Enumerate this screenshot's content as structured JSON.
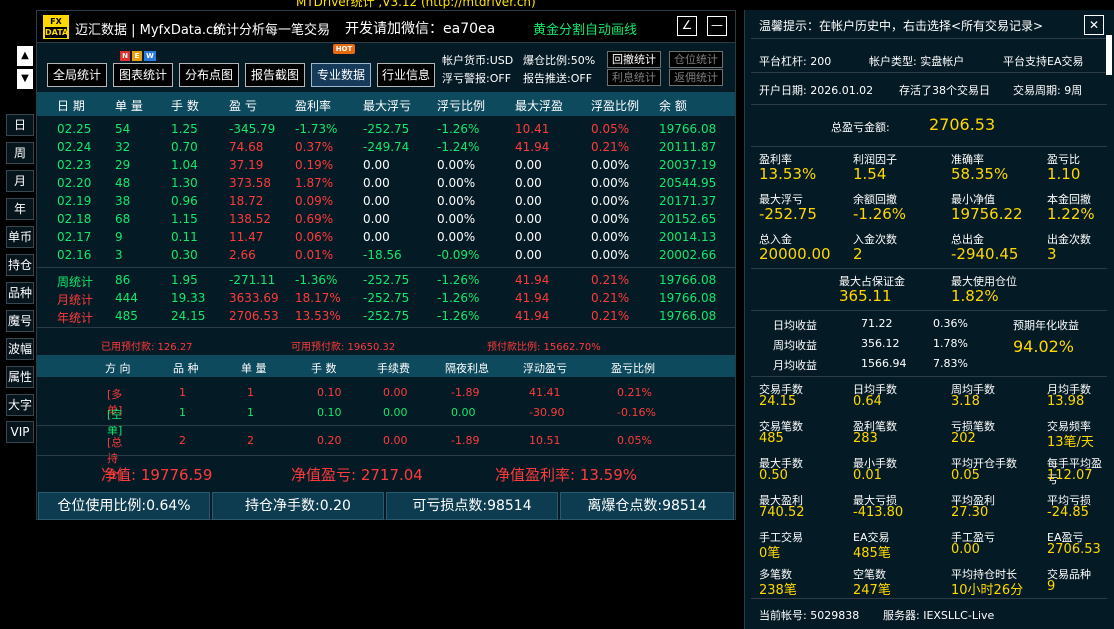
{
  "top_caption": "MTDriver统计 ,V3.12 (http://mtdriver.cn)",
  "side_nav": {
    "up": "▲",
    "down": "▼",
    "items": [
      "日",
      "周",
      "月",
      "年",
      "单币",
      "持仓",
      "品种",
      "魔号",
      "波幅",
      "属性",
      "大字",
      "VIP"
    ]
  },
  "title": {
    "logo_top": "FX",
    "logo_bottom": "DATA",
    "brand": "迈汇数据 | MyfxData.cn",
    "desc": "统计分析每一笔交易",
    "wechat": "开发请加微信：ea70ea",
    "gold": "黄金分割自动画线",
    "btn_edit": "∠",
    "btn_min": "—"
  },
  "toolbar": {
    "buttons": [
      "全局统计",
      "图表统计",
      "分布点图",
      "报告截图",
      "专业数据",
      "行业信息"
    ],
    "badges": {
      "new": [
        "N",
        "E",
        "W"
      ],
      "hot": "HOT"
    },
    "options": {
      "currency": "帐户货币:USD",
      "bust_ratio": "爆仓比例:50%",
      "float_alert": "浮亏警报:OFF",
      "report_push": "报告推送:OFF"
    },
    "small_buttons": [
      "回撤统计",
      "仓位统计",
      "利息统计",
      "返佣统计"
    ]
  },
  "table": {
    "headers": [
      "日 期",
      "单 量",
      "手 数",
      "盈 亏",
      "盈利率",
      "最大浮亏",
      "浮亏比例",
      "最大浮盈",
      "浮盈比例",
      "余 额"
    ],
    "rows": [
      [
        "02.25",
        "54",
        "1.25",
        "-345.79",
        "-1.73%",
        "-252.75",
        "-1.26%",
        "10.41",
        "0.05%",
        "19766.08"
      ],
      [
        "02.24",
        "32",
        "0.70",
        "74.68",
        "0.37%",
        "-249.74",
        "-1.24%",
        "41.94",
        "0.21%",
        "20111.87"
      ],
      [
        "02.23",
        "29",
        "1.04",
        "37.19",
        "0.19%",
        "0.00",
        "0.00%",
        "0.00",
        "0.00%",
        "20037.19"
      ],
      [
        "02.20",
        "48",
        "1.30",
        "373.58",
        "1.87%",
        "0.00",
        "0.00%",
        "0.00",
        "0.00%",
        "20544.95"
      ],
      [
        "02.19",
        "38",
        "0.96",
        "18.72",
        "0.09%",
        "0.00",
        "0.00%",
        "0.00",
        "0.00%",
        "20171.37"
      ],
      [
        "02.18",
        "68",
        "1.15",
        "138.52",
        "0.69%",
        "0.00",
        "0.00%",
        "0.00",
        "0.00%",
        "20152.65"
      ],
      [
        "02.17",
        "9",
        "0.11",
        "11.47",
        "0.06%",
        "0.00",
        "0.00%",
        "0.00",
        "0.00%",
        "20014.13"
      ],
      [
        "02.16",
        "3",
        "0.30",
        "2.66",
        "0.01%",
        "-18.56",
        "-0.09%",
        "0.00",
        "0.00%",
        "20002.66"
      ]
    ],
    "summary": [
      [
        "周统计",
        "86",
        "1.95",
        "-271.11",
        "-1.36%",
        "-252.75",
        "-1.26%",
        "41.94",
        "0.21%",
        "19766.08"
      ],
      [
        "月统计",
        "444",
        "19.33",
        "3633.69",
        "18.17%",
        "-252.75",
        "-1.26%",
        "41.94",
        "0.21%",
        "19766.08"
      ],
      [
        "年统计",
        "485",
        "24.15",
        "2706.53",
        "13.53%",
        "-252.75",
        "-1.26%",
        "41.94",
        "0.21%",
        "19766.08"
      ]
    ]
  },
  "prepay": {
    "used": "已用预付款: 126.27",
    "available": "可用预付款: 19650.32",
    "ratio": "预付款比例: 15662.70%"
  },
  "positions": {
    "headers": [
      "方 向",
      "品 种",
      "单 量",
      "手 数",
      "手续费",
      "隔夜利息",
      "浮动盈亏",
      "盈亏比例"
    ],
    "rows": [
      [
        "[多单]",
        "1",
        "1",
        "0.10",
        "0.00",
        "-1.89",
        "41.41",
        "0.21%"
      ],
      [
        "[空单]",
        "1",
        "1",
        "0.10",
        "0.00",
        "0.00",
        "-30.90",
        "-0.16%"
      ],
      [
        "[总持仓]",
        "2",
        "2",
        "0.20",
        "0.00",
        "-1.89",
        "10.51",
        "0.05%"
      ]
    ]
  },
  "equity": {
    "net": "净值: 19776.59",
    "net_pl": "净值盈亏: 2717.04",
    "net_rate": "净值盈利率: 13.59%"
  },
  "bottom_stats": [
    "仓位使用比例:0.64%",
    "持仓净手数:0.20",
    "可亏损点数:98514",
    "离爆仓点数:98514"
  ],
  "right": {
    "tip": "温馨提示：在帐户历史中，右击选择<所有交易记录>",
    "close": "✕",
    "platform": {
      "leverage": "平台杠杆: 200",
      "type": "帐户类型: 实盘帐户",
      "ea": "平台支持EA交易"
    },
    "open": {
      "date": "开户日期: 2026.01.02",
      "days": "存活了38个交易日",
      "cycle": "交易周期: 9周"
    },
    "total_pl_label": "总盈亏金额:",
    "total_pl": "2706.53",
    "grid1": [
      [
        "盈利率",
        "13.53%"
      ],
      [
        "利润因子",
        "1.54"
      ],
      [
        "准确率",
        "58.35%"
      ],
      [
        "盈亏比",
        "1.10"
      ],
      [
        "最大浮亏",
        "-252.75"
      ],
      [
        "余额回撤",
        "-1.26%"
      ],
      [
        "最小净值",
        "19756.22"
      ],
      [
        "本金回撤",
        "1.22%"
      ],
      [
        "总入金",
        "20000.00"
      ],
      [
        "入金次数",
        "2"
      ],
      [
        "总出金",
        "-2940.45"
      ],
      [
        "出金次数",
        "3"
      ]
    ],
    "margin": [
      [
        "最大占保证金",
        "365.11"
      ],
      [
        "最大使用仓位",
        "1.82%"
      ]
    ],
    "returns": {
      "rows": [
        [
          "日均收益",
          "71.22",
          "0.36%"
        ],
        [
          "周均收益",
          "356.12",
          "1.78%"
        ],
        [
          "月均收益",
          "1566.94",
          "7.83%"
        ]
      ],
      "annual_label": "预期年化收益",
      "annual": "94.02%"
    },
    "grid2": [
      [
        "交易手数",
        "24.15"
      ],
      [
        "日均手数",
        "0.64"
      ],
      [
        "周均手数",
        "3.18"
      ],
      [
        "月均手数",
        "13.98"
      ],
      [
        "交易笔数",
        "485"
      ],
      [
        "盈利笔数",
        "283"
      ],
      [
        "亏损笔数",
        "202"
      ],
      [
        "交易频率",
        "13笔/天"
      ],
      [
        "最大手数",
        "0.50"
      ],
      [
        "最小手数",
        "0.01"
      ],
      [
        "平均开仓手数",
        "0.05"
      ],
      [
        "每手平均盈亏",
        "112.07"
      ],
      [
        "最大盈利",
        "740.52"
      ],
      [
        "最大亏损",
        "-413.80"
      ],
      [
        "平均盈利",
        "27.30"
      ],
      [
        "平均亏损",
        "-24.85"
      ],
      [
        "手工交易",
        "0笔"
      ],
      [
        "EA交易",
        "485笔"
      ],
      [
        "手工盈亏",
        "0.00"
      ],
      [
        "EA盈亏",
        "2706.53"
      ],
      [
        "多笔数",
        "238笔"
      ],
      [
        "空笔数",
        "247笔"
      ],
      [
        "平均持仓时长",
        "10小时26分"
      ],
      [
        "交易品种",
        "9"
      ]
    ],
    "account": "当前帐号: 5029838",
    "server": "服务器: IEXSLLC-Live"
  }
}
